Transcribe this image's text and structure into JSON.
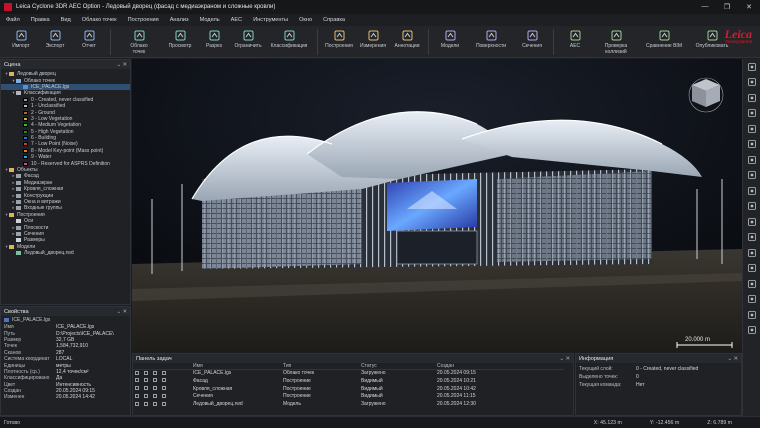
{
  "window": {
    "title": "Leica Cyclone 3DR AEC Option - Ледовый дворец (фасад с медиаэкраном и сложные кровли)",
    "controls": [
      "—",
      "❐",
      "✕"
    ]
  },
  "menu": [
    "Файл",
    "Правка",
    "Вид",
    "Облако точек",
    "Построения",
    "Анализ",
    "Модель",
    "AEC",
    "Инструменты",
    "Окно",
    "Справка"
  ],
  "ribbon": {
    "groups": [
      [
        {
          "name": "import",
          "label": "Импорт"
        },
        {
          "name": "export",
          "label": "Экспорт"
        },
        {
          "name": "report",
          "label": "Отчет"
        }
      ],
      [
        {
          "name": "cloud",
          "label": "Облако\nточек"
        },
        {
          "name": "viewer",
          "label": "Просмотр"
        },
        {
          "name": "section",
          "label": "Разрез"
        },
        {
          "name": "limit",
          "label": "Ограничить"
        },
        {
          "name": "classify",
          "label": "Классификация"
        }
      ],
      [
        {
          "name": "build",
          "label": "Построения"
        },
        {
          "name": "measure",
          "label": "Измерения"
        },
        {
          "name": "annot",
          "label": "Аннотации"
        }
      ],
      [
        {
          "name": "model",
          "label": "Модели"
        },
        {
          "name": "surface",
          "label": "Поверхности"
        },
        {
          "name": "sections",
          "label": "Сечения"
        }
      ],
      [
        {
          "name": "aec",
          "label": "AEC"
        },
        {
          "name": "clash",
          "label": "Проверка\nколлизий"
        },
        {
          "name": "bim",
          "label": "Сравнение BIM"
        },
        {
          "name": "publish",
          "label": "Опубликовать"
        }
      ]
    ]
  },
  "brand": {
    "name": "Leica",
    "sub": "Geosystems",
    "color": "#d61c2a"
  },
  "scene": {
    "title": "Сцена",
    "tree": [
      {
        "level": 0,
        "twist": "▾",
        "icon": "folder",
        "label": "Ледовый дворец"
      },
      {
        "level": 1,
        "twist": "▾",
        "icon": "cloud",
        "label": "Облако точек"
      },
      {
        "level": 2,
        "twist": "",
        "icon": "file",
        "label": "ICE_PALACE.lgs",
        "selected": true
      },
      {
        "level": 1,
        "twist": "▾",
        "icon": "layers",
        "label": "Классификация"
      },
      {
        "level": 2,
        "twist": "",
        "swatch": "#9a9a9a",
        "label": "0 - Created, never classified"
      },
      {
        "level": 2,
        "twist": "",
        "swatch": "#b8b8b8",
        "label": "1 - Unclassified"
      },
      {
        "level": 2,
        "twist": "",
        "swatch": "#a5643b",
        "label": "2 - Ground"
      },
      {
        "level": 2,
        "twist": "",
        "swatch": "#c8b234",
        "label": "3 - Low Vegetation"
      },
      {
        "level": 2,
        "twist": "",
        "swatch": "#2fbf35",
        "label": "4 - Medium Vegetation"
      },
      {
        "level": 2,
        "twist": "",
        "swatch": "#1a8a22",
        "label": "5 - High Vegetation"
      },
      {
        "level": 2,
        "twist": "",
        "swatch": "#2f6fd6",
        "label": "6 - Building"
      },
      {
        "level": 2,
        "twist": "",
        "swatch": "#cc3a3a",
        "label": "7 - Low Point (Noise)"
      },
      {
        "level": 2,
        "twist": "",
        "swatch": "#e07a2a",
        "label": "8 - Model Key-point (Mass point)"
      },
      {
        "level": 2,
        "twist": "",
        "swatch": "#36a6d8",
        "label": "9 - Water"
      },
      {
        "level": 2,
        "twist": "",
        "swatch": "#d94a8c",
        "label": "10 - Reserved for ASPRS Definition"
      },
      {
        "level": 0,
        "twist": "▾",
        "icon": "folder",
        "label": "Объекты"
      },
      {
        "level": 1,
        "twist": "▸",
        "icon": "obj",
        "label": "Фасад"
      },
      {
        "level": 1,
        "twist": "▸",
        "icon": "obj",
        "label": "Медиаэкран"
      },
      {
        "level": 1,
        "twist": "▸",
        "icon": "obj",
        "label": "Кровля_сложная"
      },
      {
        "level": 1,
        "twist": "▸",
        "icon": "obj",
        "label": "Конструкции"
      },
      {
        "level": 1,
        "twist": "▸",
        "icon": "obj",
        "label": "Окна и витражи"
      },
      {
        "level": 1,
        "twist": "▸",
        "icon": "obj",
        "label": "Входные группы"
      },
      {
        "level": 0,
        "twist": "▾",
        "icon": "folder",
        "label": "Построения"
      },
      {
        "level": 1,
        "twist": "",
        "icon": "axis",
        "label": "Оси"
      },
      {
        "level": 1,
        "twist": "▸",
        "icon": "obj",
        "label": "Плоскости"
      },
      {
        "level": 1,
        "twist": "▸",
        "icon": "obj",
        "label": "Сечения"
      },
      {
        "level": 1,
        "twist": "",
        "icon": "dim",
        "label": "Размеры"
      },
      {
        "level": 0,
        "twist": "▾",
        "icon": "folder",
        "label": "Модели"
      },
      {
        "level": 1,
        "twist": "",
        "icon": "model",
        "label": "Ледовый_дворец.rwd"
      }
    ]
  },
  "properties": {
    "title": "Свойства",
    "file": "ICE_PALACE.lgs",
    "rows": [
      {
        "k": "Имя",
        "v": "ICE_PALACE.lgs"
      },
      {
        "k": "Путь",
        "v": "D:\\Projects\\ICE_PALACE\\"
      },
      {
        "k": "Размер",
        "v": "32,7 GB"
      },
      {
        "k": "Точек",
        "v": "1,584,732,910"
      },
      {
        "k": "Сканов",
        "v": "287"
      },
      {
        "k": "Система координат",
        "v": "LOCAL"
      },
      {
        "k": "Единицы",
        "v": "метры"
      },
      {
        "k": "Плотность (ср.)",
        "v": "12,4 точек/см²"
      },
      {
        "k": "Классифицировано",
        "v": "Да"
      },
      {
        "k": "Цвет",
        "v": "Интенсивность"
      },
      {
        "k": "Создан",
        "v": "20.05.2024 09:15"
      },
      {
        "k": "Изменен",
        "v": "20.05.2024 14:42"
      }
    ]
  },
  "viewport": {
    "scale_label": "20.000 m",
    "screen_color": "#3a5fd8"
  },
  "tasks": {
    "title": "Панель задач",
    "headers": [
      "",
      "Имя",
      "Тип",
      "Статус",
      "Создан",
      ""
    ],
    "rows": [
      {
        "name": "ICE_PALACE.lgs",
        "type": "Облако точек",
        "status": "Загружено",
        "created": "20.05.2024 09:15"
      },
      {
        "name": "Фасад",
        "type": "Построение",
        "status": "Видимый",
        "created": "20.05.2024 10:21"
      },
      {
        "name": "Кровля_сложная",
        "type": "Построение",
        "status": "Видимый",
        "created": "20.05.2024 10:42"
      },
      {
        "name": "Сечения",
        "type": "Построение",
        "status": "Видимый",
        "created": "20.05.2024 11:15"
      },
      {
        "name": "Ледовый_дворец.rwd",
        "type": "Модель",
        "status": "Загружено",
        "created": "20.05.2024 12:30"
      }
    ]
  },
  "info": {
    "title": "Информация",
    "rows": [
      {
        "k": "Текущий слой:",
        "v": "0 - Created, never classified"
      },
      {
        "k": "Выделено точек:",
        "v": "0"
      },
      {
        "k": "Текущая команда:",
        "v": "Нет"
      }
    ]
  },
  "status": {
    "left": "Готово",
    "x": "X: 45.123 m",
    "y": "Y: -12.456 m",
    "z": "Z: 6.789 m"
  }
}
